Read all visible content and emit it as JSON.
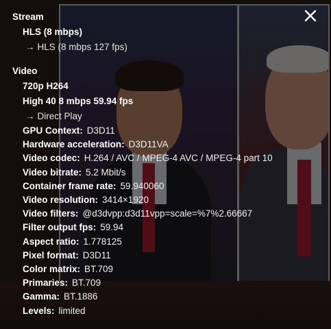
{
  "stream": {
    "heading": "Stream",
    "source": "HLS (8 mbps)",
    "output": "HLS (8 mbps 127 fps)"
  },
  "video": {
    "heading": "Video",
    "format": "720p H264",
    "profile": "High 40 8 mbps 59.94 fps",
    "playback": "Direct Play",
    "stats": [
      {
        "key": "GPU Context:",
        "value": "D3D11"
      },
      {
        "key": "Hardware acceleration:",
        "value": "D3D11VA"
      },
      {
        "key": "Video codec:",
        "value": "H.264 / AVC / MPEG-4 AVC / MPEG-4 part 10"
      },
      {
        "key": "Video bitrate:",
        "value": "5.2 Mbit/s"
      },
      {
        "key": "Container frame rate:",
        "value": "59.940060"
      },
      {
        "key": "Video resolution:",
        "value": "3414×1920"
      },
      {
        "key": "Video filters:",
        "value": "@d3dvpp:d3d11vpp=scale=%7%2.66667"
      },
      {
        "key": "Filter output fps:",
        "value": "59.94"
      },
      {
        "key": "Aspect ratio:",
        "value": "1.778125"
      },
      {
        "key": "Pixel format:",
        "value": "D3D11"
      },
      {
        "key": "Color matrix:",
        "value": "BT.709"
      },
      {
        "key": "Primaries:",
        "value": "BT.709"
      },
      {
        "key": "Gamma:",
        "value": "BT.1886"
      },
      {
        "key": "Levels:",
        "value": "limited"
      }
    ]
  },
  "icons": {
    "close": "close-icon",
    "arrow": "→"
  },
  "colors": {
    "text": "#ffffff",
    "overlay": "rgba(0,0,0,0.55)",
    "border": "#c8c8c8"
  }
}
